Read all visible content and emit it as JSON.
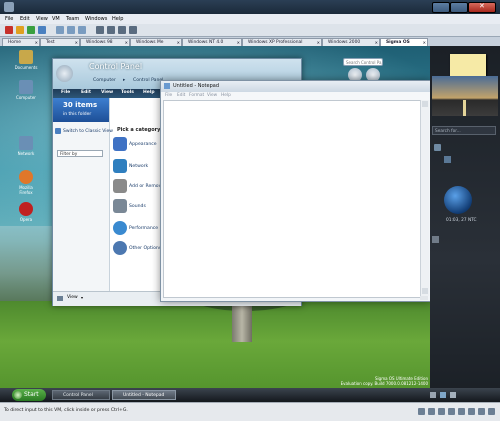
{
  "host": {
    "title": "",
    "menu": [
      "File",
      "Edit",
      "View",
      "VM",
      "Team",
      "Windows",
      "Help"
    ],
    "tabs": [
      {
        "label": "Home",
        "active": false
      },
      {
        "label": "Test",
        "active": false
      },
      {
        "label": "Windows 98",
        "active": false
      },
      {
        "label": "Windows Me",
        "active": false
      },
      {
        "label": "Windows NT 4.0",
        "active": false
      },
      {
        "label": "Windows XP Professional",
        "active": false
      },
      {
        "label": "Windows 2000",
        "active": false
      },
      {
        "label": "Sigma OS",
        "active": true
      }
    ],
    "status_text": "To direct input to this VM, click inside or press Ctrl+G."
  },
  "desktop": {
    "icons": [
      {
        "label": "Documents",
        "color": "#c8a84a"
      },
      {
        "label": "Computer",
        "color": "#6a8fb5"
      },
      {
        "label": "Network",
        "color": "#6a8fb5"
      },
      {
        "label": "Mozilla Firefox",
        "color": "#e0772a"
      },
      {
        "label": "Opera",
        "color": "#c02020"
      }
    ],
    "watermark_line1": "Sigma OS Ultimate Edition",
    "watermark_line2": "Evaluation copy. Build 7000.0.081212-1400"
  },
  "control_panel": {
    "title": "Control Panel",
    "breadcrumb": [
      "Computer",
      "Control Panel"
    ],
    "search_placeholder": "Search Control Pa...",
    "menu": [
      "File",
      "Edit",
      "View",
      "Tools",
      "Help"
    ],
    "item_count": "30 items",
    "item_count_sub": "in this folder",
    "switch_view": "Switch to Classic View",
    "filter_placeholder": "Filter by",
    "pick_category": "Pick a category",
    "categories": [
      {
        "label": "Appearance",
        "color": "#3f72c4"
      },
      {
        "label": "Network",
        "color": "#2f7fbf"
      },
      {
        "label": "Add or Remove",
        "color": "#8a8a8a"
      },
      {
        "label": "Sounds",
        "color": "#7a8896"
      },
      {
        "label": "Performance",
        "color": "#3a8ad0"
      },
      {
        "label": "Other Options",
        "color": "#4c78b0"
      }
    ],
    "view_label": "View"
  },
  "notepad": {
    "title": "Untitled - Notepad",
    "menu": [
      "File",
      "Edit",
      "Format",
      "View",
      "Help"
    ],
    "content": ""
  },
  "sidebar": {
    "search_placeholder": "Search for...",
    "clock_text": "01:03, 27 NTC"
  },
  "taskbar": {
    "start_label": "Start",
    "items": [
      {
        "label": "Control Panel"
      },
      {
        "label": "Untitled - Notepad"
      }
    ]
  }
}
